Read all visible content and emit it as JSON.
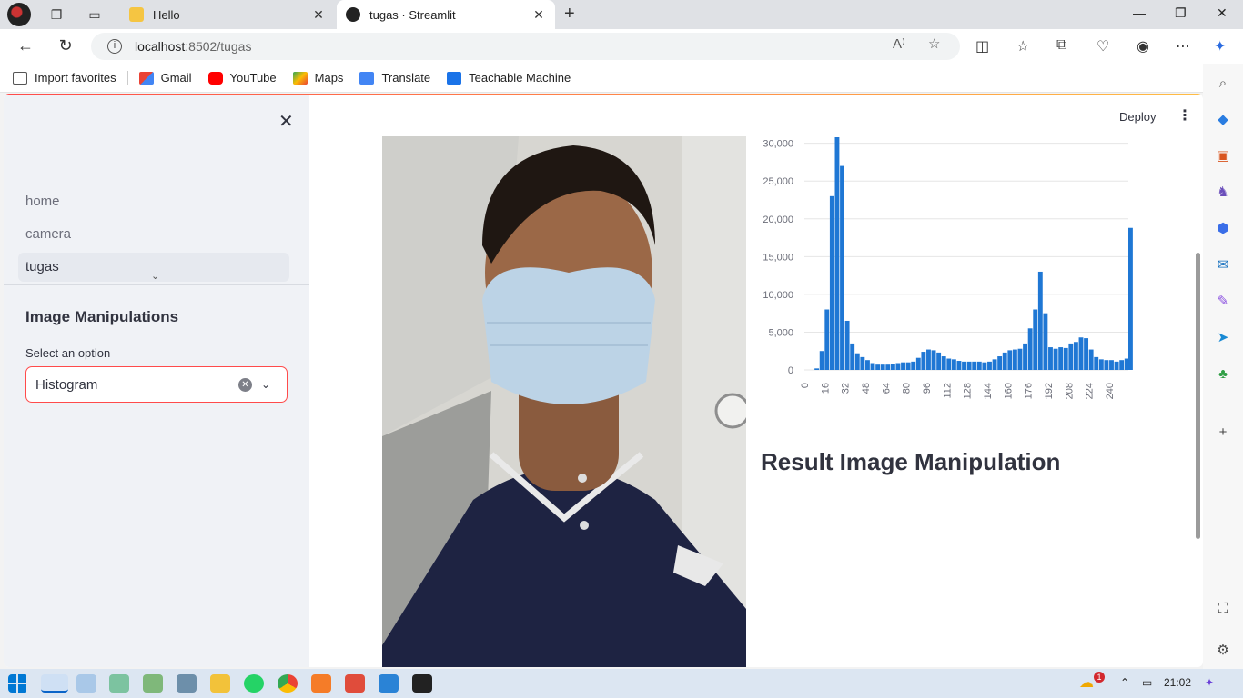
{
  "browser": {
    "tabs": [
      {
        "title": "Hello",
        "active": false
      },
      {
        "title": "tugas · Streamlit",
        "active": true
      }
    ],
    "url_host": "localhost",
    "url_path": ":8502/tugas",
    "bookmarks": [
      "Import favorites",
      "Gmail",
      "YouTube",
      "Maps",
      "Translate",
      "Teachable Machine"
    ]
  },
  "sidebar": {
    "nav": [
      "home",
      "camera",
      "tugas"
    ],
    "active_nav": "tugas",
    "heading": "Image Manipulations",
    "select_label": "Select an option",
    "select_value": "Histogram"
  },
  "header": {
    "deploy_label": "Deploy"
  },
  "main": {
    "result_title": "Result Image Manipulation"
  },
  "taskbar": {
    "time": "21:02",
    "weather_badge": "1"
  },
  "colors": {
    "accent": "#ff4b4b",
    "bar": "#1f77d4",
    "sidebar_bg": "#f0f2f6"
  },
  "chart_data": {
    "type": "bar",
    "x": [
      0,
      4,
      8,
      12,
      16,
      20,
      24,
      28,
      32,
      36,
      40,
      44,
      48,
      52,
      56,
      60,
      64,
      68,
      72,
      76,
      80,
      84,
      88,
      92,
      96,
      100,
      104,
      108,
      112,
      116,
      120,
      124,
      128,
      132,
      136,
      140,
      144,
      148,
      152,
      156,
      160,
      164,
      168,
      172,
      176,
      180,
      184,
      188,
      192,
      196,
      200,
      204,
      208,
      212,
      216,
      220,
      224,
      228,
      232,
      236,
      240,
      244,
      248,
      252,
      255
    ],
    "values": [
      0,
      0,
      200,
      2500,
      8000,
      23000,
      30800,
      27000,
      6500,
      3500,
      2200,
      1700,
      1300,
      900,
      700,
      700,
      700,
      800,
      900,
      1000,
      1000,
      1100,
      1600,
      2400,
      2700,
      2600,
      2300,
      1800,
      1500,
      1400,
      1200,
      1100,
      1100,
      1100,
      1100,
      1000,
      1100,
      1400,
      1800,
      2300,
      2600,
      2700,
      2800,
      3500,
      5500,
      8000,
      13000,
      7500,
      3000,
      2800,
      3000,
      2900,
      3500,
      3700,
      4300,
      4200,
      2700,
      1700,
      1400,
      1300,
      1300,
      1100,
      1300,
      1500,
      18800
    ],
    "xticks": [
      0,
      16,
      32,
      48,
      64,
      80,
      96,
      112,
      128,
      144,
      160,
      176,
      192,
      208,
      224,
      240
    ],
    "yticks": [
      0,
      5000,
      10000,
      15000,
      20000,
      25000,
      30000
    ],
    "ytick_labels": [
      "0",
      "5,000",
      "10,000",
      "15,000",
      "20,000",
      "25,000",
      "30,000"
    ],
    "xlim": [
      0,
      255
    ],
    "ylim": [
      0,
      30800
    ],
    "grid": true
  }
}
